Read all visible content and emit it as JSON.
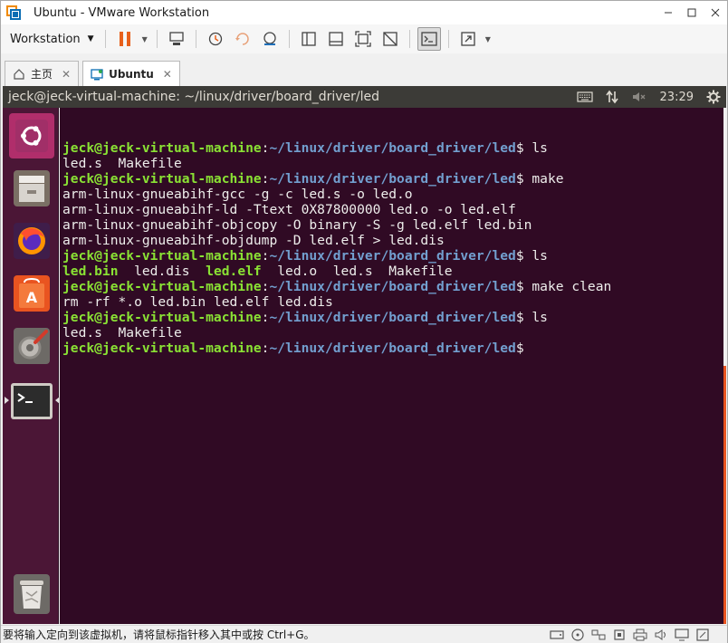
{
  "window": {
    "title": "Ubuntu - VMware Workstation",
    "controls": [
      "minimize-icon",
      "maximize-icon",
      "close-icon"
    ]
  },
  "toolbar": {
    "workstation_menu_label": "Workstation",
    "buttons": [
      "pause-icon",
      "send-ctrl-alt-del-icon",
      "snapshot-icon",
      "revert-snapshot-icon",
      "snapshot-manager-icon",
      "sidebar-icon",
      "console-view-icon",
      "fullscreen-icon",
      "unity-icon",
      "terminal-view-icon",
      "stretch-icon"
    ]
  },
  "tabs": [
    {
      "label": "主页",
      "icon": "home-icon",
      "active": false
    },
    {
      "label": "Ubuntu",
      "icon": "vm-icon",
      "active": true
    }
  ],
  "ubuntu_bar": {
    "window_title": "jeck@jeck-virtual-machine: ~/linux/driver/board_driver/led",
    "clock": "23:29",
    "indicators": [
      "keyboard-icon",
      "network-icon",
      "volume-muted-icon",
      "gear-icon"
    ]
  },
  "launcher": {
    "items": [
      {
        "name": "ubuntu-dash-icon"
      },
      {
        "name": "files-icon"
      },
      {
        "name": "firefox-icon"
      },
      {
        "name": "software-center-icon"
      },
      {
        "name": "system-settings-icon"
      },
      {
        "name": "terminal-icon",
        "active": true
      }
    ],
    "trash": "trash-icon"
  },
  "terminal": {
    "user_host": "jeck@jeck-virtual-machine",
    "path": "~/linux/driver/board_driver/led",
    "lines": [
      {
        "type": "prompt",
        "cmd": " ls"
      },
      {
        "type": "out",
        "text": "led.s  Makefile"
      },
      {
        "type": "prompt",
        "cmd": " make"
      },
      {
        "type": "out",
        "text": "arm-linux-gnueabihf-gcc -g -c led.s -o led.o"
      },
      {
        "type": "out",
        "text": "arm-linux-gnueabihf-ld -Ttext 0X87800000 led.o -o led.elf"
      },
      {
        "type": "out",
        "text": "arm-linux-gnueabihf-objcopy -O binary -S -g led.elf led.bin"
      },
      {
        "type": "out",
        "text": "arm-linux-gnueabihf-objdump -D led.elf > led.dis"
      },
      {
        "type": "prompt",
        "cmd": " ls"
      },
      {
        "type": "ls",
        "items": [
          {
            "text": "led.bin",
            "exec": true
          },
          {
            "text": "  led.dis  ",
            "exec": false
          },
          {
            "text": "led.elf",
            "exec": true
          },
          {
            "text": "  led.o  led.s  Makefile",
            "exec": false
          }
        ]
      },
      {
        "type": "prompt",
        "cmd": " make clean"
      },
      {
        "type": "out",
        "text": "rm -rf *.o led.bin led.elf led.dis"
      },
      {
        "type": "prompt",
        "cmd": " ls"
      },
      {
        "type": "out",
        "text": "led.s  Makefile"
      },
      {
        "type": "prompt",
        "cmd": ""
      }
    ]
  },
  "statusbar": {
    "hint": "要将输入定向到该虚拟机，请将鼠标指针移入其中或按 Ctrl+G。",
    "icons": [
      "hdd-icon",
      "cdrom-icon",
      "network-adapter-icon",
      "usb-icon",
      "printer-icon",
      "sound-icon",
      "display-icon",
      "message-icon"
    ]
  },
  "colors": {
    "terminal_bg": "#300a24",
    "prompt_user": "#8ae234",
    "prompt_path": "#729fcf",
    "text": "#eeeeec",
    "launcher_bg": "#4b1636",
    "ubuntu_bar": "#3c3b37",
    "accent": "#e95420"
  }
}
